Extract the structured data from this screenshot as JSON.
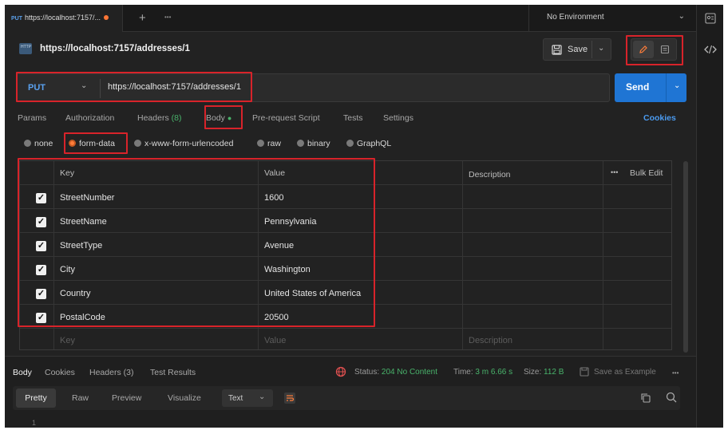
{
  "tab": {
    "method": "PUT",
    "title": "https://localhost:7157/...",
    "new_tab": "+",
    "more": "•••"
  },
  "environment": {
    "label": "No Environment",
    "chevron": "⌄"
  },
  "header": {
    "icon": "http-icon",
    "title": "https://localhost:7157/addresses/1",
    "save_label": "Save"
  },
  "request": {
    "method": "PUT",
    "url": "https://localhost:7157/addresses/1",
    "send_label": "Send"
  },
  "request_tabs": {
    "params": "Params",
    "authorization": "Authorization",
    "headers": "Headers",
    "headers_count": "(8)",
    "body": "Body",
    "pre_request": "Pre-request Script",
    "tests": "Tests",
    "settings": "Settings",
    "cookies": "Cookies"
  },
  "body_types": {
    "none": "none",
    "form_data": "form-data",
    "urlencoded": "x-www-form-urlencoded",
    "raw": "raw",
    "binary": "binary",
    "graphql": "GraphQL"
  },
  "table": {
    "headers": {
      "key": "Key",
      "value": "Value",
      "description": "Description",
      "bulk_edit": "Bulk Edit",
      "more": "•••"
    },
    "rows": [
      {
        "key": "StreetNumber",
        "value": "1600",
        "checked": true
      },
      {
        "key": "StreetName",
        "value": "Pennsylvania",
        "checked": true
      },
      {
        "key": "StreetType",
        "value": "Avenue",
        "checked": true
      },
      {
        "key": "City",
        "value": "Washington",
        "checked": true
      },
      {
        "key": "Country",
        "value": "United States of America",
        "checked": true
      },
      {
        "key": "PostalCode",
        "value": "20500",
        "checked": true
      }
    ],
    "placeholders": {
      "key": "Key",
      "value": "Value",
      "description": "Description"
    }
  },
  "response": {
    "tabs": {
      "body": "Body",
      "cookies": "Cookies",
      "headers": "Headers (3)",
      "test_results": "Test Results"
    },
    "status_label": "Status:",
    "status_value": "204 No Content",
    "time_label": "Time:",
    "time_value": "3 m 6.66 s",
    "size_label": "Size:",
    "size_value": "112 B",
    "save_example": "Save as Example",
    "more": "•••",
    "view_tabs": {
      "pretty": "Pretty",
      "raw": "Raw",
      "preview": "Preview",
      "visualize": "Visualize",
      "format": "Text"
    },
    "line_number": "1"
  },
  "colors": {
    "accent": "#1f75d4",
    "method": "#5aa1ef",
    "highlight": "#d8232a",
    "status_ok": "#49b36b",
    "unsaved": "#ff7636"
  }
}
